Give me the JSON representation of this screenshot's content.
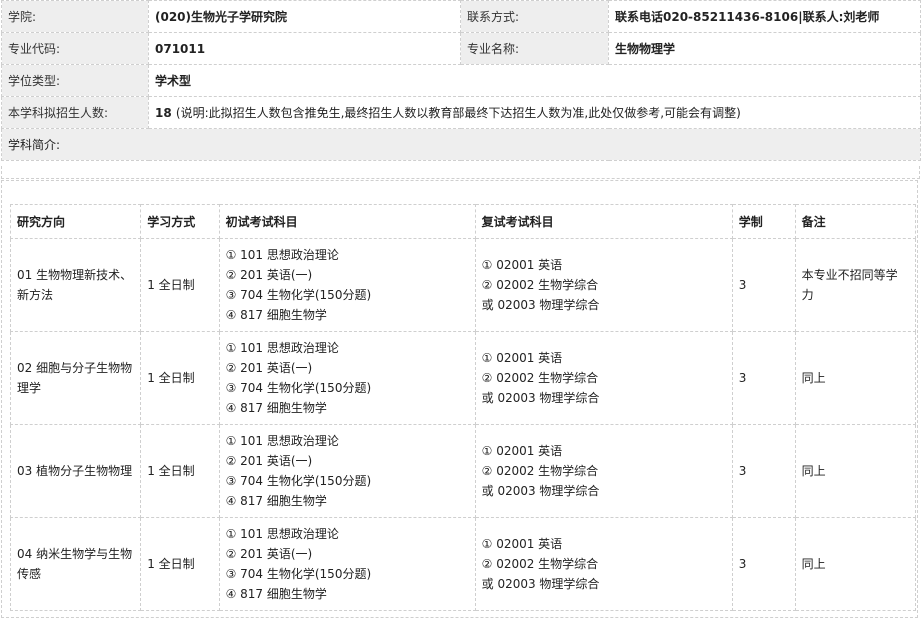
{
  "info": {
    "college_label": "学院:",
    "college_value": "(020)生物光子学研究院",
    "contact_label": "联系方式:",
    "contact_value": "联系电话020-85211436-8106|联系人:刘老师",
    "major_code_label": "专业代码:",
    "major_code_value": "071011",
    "major_name_label": "专业名称:",
    "major_name_value": "生物物理学",
    "degree_type_label": "学位类型:",
    "degree_type_value": "学术型",
    "enroll_label": "本学科拟招生人数:",
    "enroll_value": "18",
    "enroll_note": "(说明:此拟招生人数包含推免生,最终招生人数以教育部最终下达招生人数为准,此处仅做参考,可能会有调整)",
    "intro_label": "学科简介:"
  },
  "table": {
    "headers": [
      "研究方向",
      "学习方式",
      "初试考试科目",
      "复试考试科目",
      "学制",
      "备注"
    ],
    "rows": [
      {
        "direction": [
          "01 生物物理新技术、",
          "新方法"
        ],
        "mode": "1 全日制",
        "first_exam": [
          "① 101 思想政治理论",
          "② 201 英语(一)",
          "③ 704 生物化学(150分题)",
          "④ 817 细胞生物学"
        ],
        "second_exam": [
          "① 02001 英语",
          "② 02002 生物学综合",
          "或 02003 物理学综合"
        ],
        "years": "3",
        "note": "本专业不招同等学力"
      },
      {
        "direction": [
          "02 细胞与分子生物物",
          "理学"
        ],
        "mode": "1 全日制",
        "first_exam": [
          "① 101 思想政治理论",
          "② 201 英语(一)",
          "③ 704 生物化学(150分题)",
          "④ 817 细胞生物学"
        ],
        "second_exam": [
          "① 02001 英语",
          "② 02002 生物学综合",
          "或 02003 物理学综合"
        ],
        "years": "3",
        "note": "同上"
      },
      {
        "direction": [
          "03 植物分子生物物理"
        ],
        "mode": "1 全日制",
        "first_exam": [
          "① 101 思想政治理论",
          "② 201 英语(一)",
          "③ 704 生物化学(150分题)",
          "④ 817 细胞生物学"
        ],
        "second_exam": [
          "① 02001 英语",
          "② 02002 生物学综合",
          "或 02003 物理学综合"
        ],
        "years": "3",
        "note": "同上"
      },
      {
        "direction": [
          "04 纳米生物学与生物",
          "传感"
        ],
        "mode": "1 全日制",
        "first_exam": [
          "① 101 思想政治理论",
          "② 201 英语(一)",
          "③ 704 生物化学(150分题)",
          "④ 817 细胞生物学"
        ],
        "second_exam": [
          "① 02001 英语",
          "② 02002 生物学综合",
          "或 02003 物理学综合"
        ],
        "years": "3",
        "note": "同上"
      }
    ]
  }
}
